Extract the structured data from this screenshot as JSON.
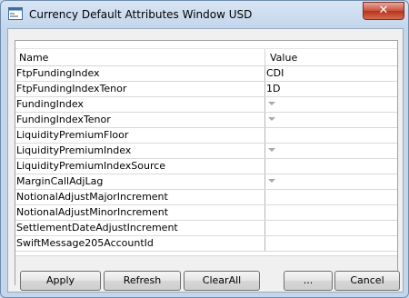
{
  "window": {
    "title": "Currency Default Attributes Window USD",
    "close_label": "✕"
  },
  "grid": {
    "columns": {
      "name": "Name",
      "value": "Value"
    },
    "rows": [
      {
        "name": "FtpFundingIndex",
        "value": "CDI",
        "dropdown": false
      },
      {
        "name": "FtpFundingIndexTenor",
        "value": "1D",
        "dropdown": false
      },
      {
        "name": "FundingIndex",
        "value": "",
        "dropdown": true
      },
      {
        "name": "FundingIndexTenor",
        "value": "",
        "dropdown": true
      },
      {
        "name": "LiquidityPremiumFloor",
        "value": "",
        "dropdown": false
      },
      {
        "name": "LiquidityPremiumIndex",
        "value": "",
        "dropdown": true
      },
      {
        "name": "LiquidityPremiumIndexSource",
        "value": "",
        "dropdown": false
      },
      {
        "name": "MarginCallAdjLag",
        "value": "",
        "dropdown": true
      },
      {
        "name": "NotionalAdjustMajorIncrement",
        "value": "",
        "dropdown": false
      },
      {
        "name": "NotionalAdjustMinorIncrement",
        "value": "",
        "dropdown": false
      },
      {
        "name": "SettlementDateAdjustIncrement",
        "value": "",
        "dropdown": false
      },
      {
        "name": "SwiftMessage205AccountId",
        "value": "",
        "dropdown": false
      }
    ]
  },
  "buttons": {
    "apply": "Apply",
    "refresh": "Refresh",
    "clear_all": "ClearAll",
    "more": "...",
    "cancel": "Cancel"
  }
}
